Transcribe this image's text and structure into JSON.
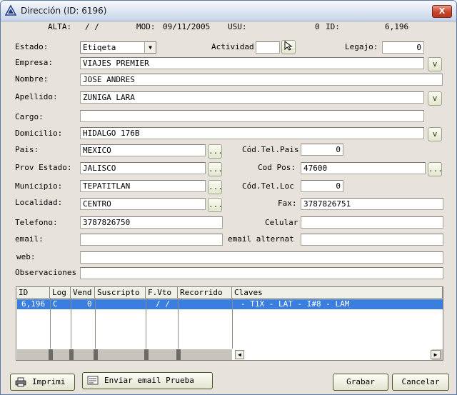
{
  "window": {
    "title": "Dirección (ID: 6196)",
    "close_label": "X"
  },
  "header": {
    "alta_label": "ALTA:",
    "alta_value": "/  /",
    "mod_label": "MOD:",
    "mod_value": "09/11/2005",
    "usu_label": "USU:",
    "usu_value": "0",
    "id_label": "ID:",
    "id_value": "6,196"
  },
  "form": {
    "estado_label": "Estado:",
    "estado_value": "Etiqeta",
    "actividad_label": "Actividad",
    "actividad_value": "",
    "legajo_label": "Legajo:",
    "legajo_value": "0",
    "empresa_label": "Empresa:",
    "empresa_value": "VIAJES PREMIER",
    "nombre_label": "Nombre:",
    "nombre_value": "JOSE ANDRES",
    "apellido_label": "Apellido:",
    "apellido_value": "ZUNIGA LARA",
    "cargo_label": "Cargo:",
    "cargo_value": "",
    "domicilio_label": "Domicilio:",
    "domicilio_value": "HIDALGO 176B",
    "pais_label": "Pais:",
    "pais_value": "MEXICO",
    "codtelpais_label": "Cód.Tel.Pais",
    "codtelpais_value": "0",
    "provestado_label": "Prov Estado:",
    "provestado_value": "JALISCO",
    "codpos_label": "Cod Pos:",
    "codpos_value": "47600",
    "municipio_label": "Municipio:",
    "municipio_value": "TEPATITLAN",
    "codtelloc_label": "Cód.Tel.Loc",
    "codtelloc_value": "0",
    "localidad_label": "Localidad:",
    "localidad_value": "CENTRO",
    "fax_label": "Fax:",
    "fax_value": "3787826751",
    "telefono_label": "Telefono:",
    "telefono_value": "3787826750",
    "celular_label": "Celular",
    "celular_value": "",
    "email_label": "email:",
    "email_value": "",
    "emailalt_label": "email alternat",
    "emailalt_value": "",
    "web_label": "web:",
    "web_value": "",
    "obs_label": "Observaciones",
    "obs_value": "",
    "v_label": "v",
    "dots_label": "..."
  },
  "grid": {
    "columns": [
      "ID",
      "Log",
      "Vend",
      "Suscripto",
      "F.Vto",
      "Recorrido",
      "Claves"
    ],
    "row": {
      "id": "6,196",
      "log": "C",
      "vend": "0",
      "suscripto": "",
      "fvto": "/  /",
      "recorrido": "",
      "claves": "- T1X - LAT - I#8 - LAM"
    }
  },
  "buttons": {
    "imprimir": "Imprimi",
    "enviar": "Enviar email Prueba",
    "grabar": "Grabar",
    "cancelar": "Cancelar"
  },
  "colors": {
    "title_gradient": "#d9e3f0",
    "selection": "#3a7fe0",
    "close": "#c8442b",
    "window_bg": "#e7e3dc"
  },
  "icons": {
    "app": "triangle-app-icon",
    "close": "close-icon",
    "printer": "printer-icon",
    "email": "email-icon",
    "lookup": "lookup-cursor-icon"
  }
}
